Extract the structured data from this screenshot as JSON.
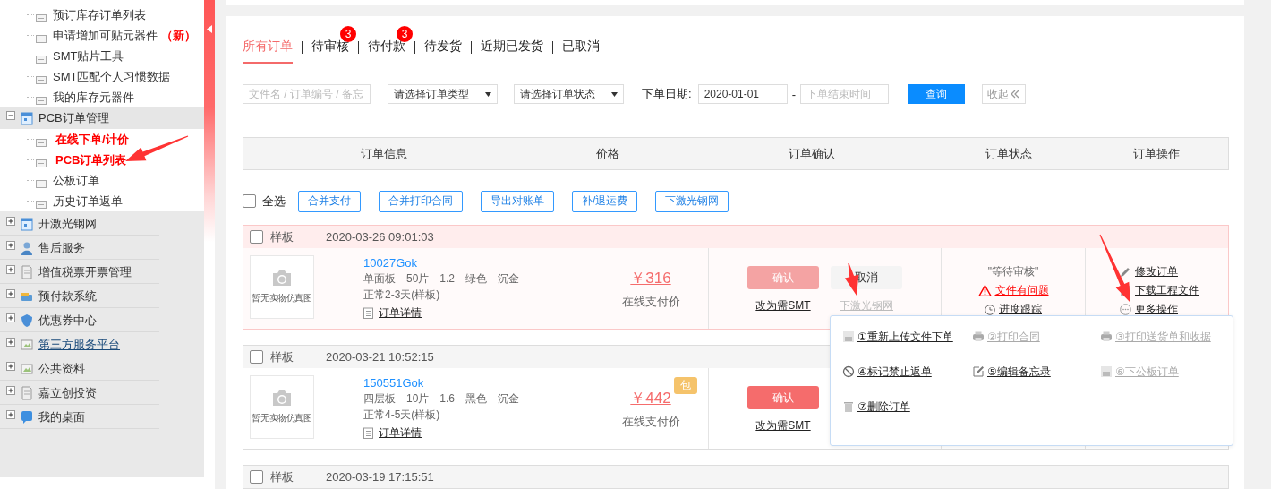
{
  "sidebar": {
    "top_children": [
      {
        "label": "预订库存订单列表",
        "highlighted": false
      },
      {
        "label": "申请增加可贴元器件",
        "badge": "（新）",
        "highlighted": false
      },
      {
        "label": "SMT贴片工具",
        "highlighted": false
      },
      {
        "label": "SMT匹配个人习惯数据",
        "highlighted": false
      },
      {
        "label": "我的库存元器件",
        "highlighted": false
      }
    ],
    "groups": [
      {
        "label": "PCB订单管理",
        "expanded": true,
        "link": false,
        "children": [
          {
            "label": "在线下单/计价",
            "highlighted": true
          },
          {
            "label": "PCB订单列表",
            "highlighted": true
          },
          {
            "label": "公板订单",
            "highlighted": false
          },
          {
            "label": "历史订单返单",
            "highlighted": false
          }
        ]
      },
      {
        "label": "开激光钢网",
        "expanded": false,
        "link": false
      },
      {
        "label": "售后服务",
        "expanded": false,
        "link": false
      },
      {
        "label": "增值税票开票管理",
        "expanded": false,
        "link": false
      },
      {
        "label": "预付款系统",
        "expanded": false,
        "link": false
      },
      {
        "label": "优惠券中心",
        "expanded": false,
        "link": false
      },
      {
        "label": "第三方服务平台",
        "expanded": false,
        "link": true
      },
      {
        "label": "公共资料",
        "expanded": false,
        "link": false
      },
      {
        "label": "嘉立创投资",
        "expanded": false,
        "link": false
      },
      {
        "label": "我的桌面",
        "expanded": false,
        "link": false
      }
    ]
  },
  "tabs": [
    {
      "label": "所有订单",
      "selected": true
    },
    {
      "label": "待审核",
      "badge": "3",
      "selected": false
    },
    {
      "label": "待付款",
      "badge": "3",
      "selected": false
    },
    {
      "label": "待发货",
      "selected": false
    },
    {
      "label": "近期已发货",
      "selected": false
    },
    {
      "label": "已取消",
      "selected": false
    }
  ],
  "filters": {
    "search": {
      "placeholder": "文件名 / 订单编号 / 备忘"
    },
    "selects": [
      {
        "value": "请选择订单类型"
      },
      {
        "value": "请选择订单状态"
      }
    ],
    "date_label": "下单日期:",
    "date_from": {
      "value": "2020-01-01"
    },
    "separator": "-",
    "date_to": {
      "placeholder": "下单结束时间"
    },
    "query_button": "查询",
    "collapse_button": "收起"
  },
  "table": {
    "columns": [
      "订单信息",
      "价格",
      "订单确认",
      "订单状态",
      "订单操作"
    ]
  },
  "bulk": {
    "select_all": {
      "label": "全选",
      "checked": false
    },
    "buttons": [
      "合并支付",
      "合并打印合同",
      "导出对账单",
      "补/退运费",
      "下激光钢网"
    ]
  },
  "orders": [
    {
      "type": "样板",
      "time": "2020-03-26 09:01:03",
      "checked": false,
      "highlighted": true,
      "image_text": "暂无实物仿真图",
      "id": "10027Gok",
      "specs": [
        "单面板",
        "50片",
        "1.2",
        "绿色",
        "沉金"
      ],
      "lead_time": "正常2-3天(样板)",
      "detail_link": "订单详情",
      "price": "￥316",
      "price_note": "在线支付价",
      "confirm": {
        "label": "确认",
        "disabled": true
      },
      "cancel": "取消",
      "links": [
        {
          "label": "改为需SMT",
          "disabled": false
        },
        {
          "label": "下激光钢网",
          "disabled": true
        }
      ],
      "status": {
        "text": "\"等待审核\"",
        "problem": "文件有问题",
        "progress": "进度跟踪"
      },
      "actions": [
        {
          "label": "修改订单",
          "kind": "edit"
        },
        {
          "label": "下载工程文件",
          "kind": "download"
        },
        {
          "label": "更多操作",
          "kind": "more"
        }
      ],
      "more_menu": [
        {
          "label": "①重新上传文件下单",
          "kind": "file",
          "disabled": false
        },
        {
          "label": "②打印合同",
          "kind": "print",
          "disabled": true
        },
        {
          "label": "③打印送货单和收据",
          "kind": "print",
          "disabled": true
        },
        {
          "label": "④标记禁止返单",
          "kind": "ban",
          "disabled": false
        },
        {
          "label": "⑤编辑备忘录",
          "kind": "edit",
          "disabled": false
        },
        {
          "label": "⑥下公板订单",
          "kind": "file",
          "disabled": true
        },
        {
          "label": "⑦删除订单",
          "kind": "trash",
          "disabled": false
        }
      ]
    },
    {
      "type": "样板",
      "time": "2020-03-21 10:52:15",
      "checked": false,
      "highlighted": false,
      "image_text": "暂无实物仿真图",
      "id": "150551Gok",
      "specs": [
        "四层板",
        "10片",
        "1.6",
        "黑色",
        "沉金"
      ],
      "lead_time": "正常4-5天(样板)",
      "detail_link": "订单详情",
      "price": "￥442",
      "shipping_badge": "包",
      "price_note": "在线支付价",
      "confirm": {
        "label": "确认",
        "disabled": false
      },
      "links": [
        {
          "label": "改为需SMT",
          "disabled": false
        }
      ]
    },
    {
      "type": "样板",
      "time": "2020-03-19 17:15:51",
      "checked": false,
      "highlighted": false
    }
  ]
}
